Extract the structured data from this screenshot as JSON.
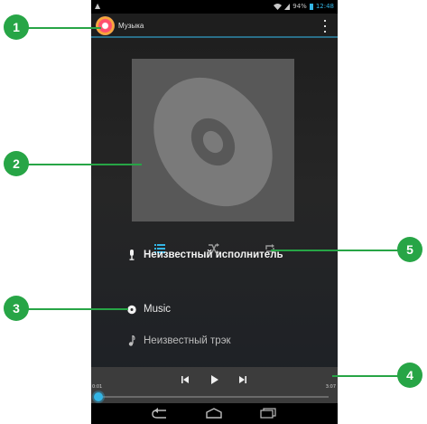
{
  "status_bar": {
    "signal_text": "▲",
    "battery": "94%",
    "clock": "12:48"
  },
  "action_bar": {
    "title": "Музыка",
    "menu_icon": "overflow-menu-icon"
  },
  "album_art": {
    "icon": "cd-disc-icon"
  },
  "controls": {
    "queue_icon": "queue-list-icon",
    "shuffle_icon": "shuffle-icon",
    "repeat_icon": "repeat-icon"
  },
  "track_info": {
    "artist": "Неизвестный исполнитель",
    "album": "Music",
    "track": "Неизвестный трэк"
  },
  "player": {
    "elapsed": "0:01",
    "duration": "3:07",
    "progress_fraction": 0.0
  },
  "callouts": [
    "1",
    "2",
    "3",
    "4",
    "5"
  ],
  "colors": {
    "accent": "#33b5e5",
    "callout_green": "#27a546"
  }
}
